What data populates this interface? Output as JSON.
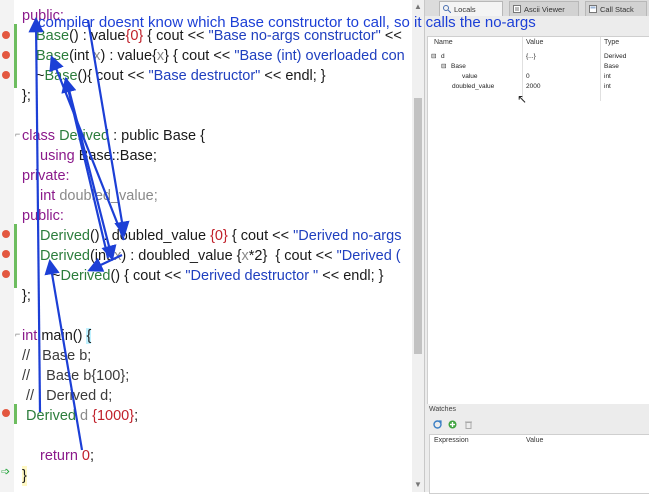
{
  "annotation": "compiler doesnt know which Base constructor to call, so it calls the no-args",
  "code": {
    "public1": "public:",
    "base_noargs_pre": "Base",
    "base_noargs_mid": "() : value",
    "base_noargs_num": "{0}",
    "base_noargs_mid2": " { cout << ",
    "base_noargs_str": "\"Base no-args constructor\"",
    "base_noargs_tail": " <<",
    "base_int_name": "Base",
    "base_int_a": "(int ",
    "base_int_p": "x",
    "base_int_b": ") : value{",
    "base_int_p2": "x",
    "base_int_c": "} { cout << ",
    "base_int_str": "\"Base (int) overloaded con",
    "base_dtor_a": "~",
    "base_dtor_name": "Base",
    "base_dtor_b": "(){ cout << ",
    "base_dtor_str": "\"Base destructor\"",
    "base_dtor_c": " << endl; }",
    "close1": "};",
    "class_kw": "class",
    "class_name": "Derived",
    "class_rest": " : public Base {",
    "using_kw": "using",
    "using_rest": " Base::Base;",
    "private": "private:",
    "int_kw": "int",
    "doubled": " doubled_value;",
    "public2": "public:",
    "der_noargs_name": "Derived",
    "der_noargs_a": "() : doubled_value ",
    "der_noargs_num": "{0}",
    "der_noargs_b": " { cout << ",
    "der_noargs_str": "\"Derived no-args",
    "der_int_name": "Derived",
    "der_int_a": "(int ",
    "der_int_p": "x",
    "der_int_b": ") : doubled_value {",
    "der_int_p2": "x",
    "der_int_c": "*2}  { cout << ",
    "der_int_str": "\"Derived (",
    "der_dtor_a": "~",
    "der_dtor_name": "Derived",
    "der_dtor_b": "() { cout << ",
    "der_dtor_str": "\"Derived destructor \"",
    "der_dtor_c": " << endl; }",
    "close2": "};",
    "main_kw": "int",
    "main_rest": " main() ",
    "main_brace": "{",
    "cm1": "//   Base b;",
    "cm2": "//    Base b{100};",
    "cm3": " //   Derived d;",
    "decl_type": " Derived",
    "decl_var": " d ",
    "decl_num": "{1000}",
    "decl_end": ";",
    "ret_kw": "return",
    "ret_num": " 0",
    "ret_end": ";",
    "close3": "}"
  },
  "tabs": [
    {
      "label": "Locals",
      "icon": "locals-icon"
    },
    {
      "label": "Ascii Viewer",
      "icon": "ascii-viewer-icon"
    },
    {
      "label": "Call Stack",
      "icon": "call-stack-icon"
    }
  ],
  "locals": {
    "headers": {
      "name": "Name",
      "value": "Value",
      "type": "Type"
    },
    "rows": [
      {
        "name": "d",
        "value": "{...}",
        "type": "Derived",
        "expander": "⊟"
      },
      {
        "name": "Base",
        "value": "",
        "type": "Base",
        "expander": "⊟"
      },
      {
        "name": "value",
        "value": "0",
        "type": "int",
        "expander": ""
      },
      {
        "name": "doubled_value",
        "value": "2000",
        "type": "int",
        "expander": ""
      }
    ]
  },
  "watches": {
    "title": "Watches",
    "headers": {
      "expression": "Expression",
      "value": "Value"
    }
  },
  "colors": {
    "annotation": "#1c3fd6",
    "breakpoint": "#e3573f",
    "change_bar": "#6dbd5f"
  }
}
